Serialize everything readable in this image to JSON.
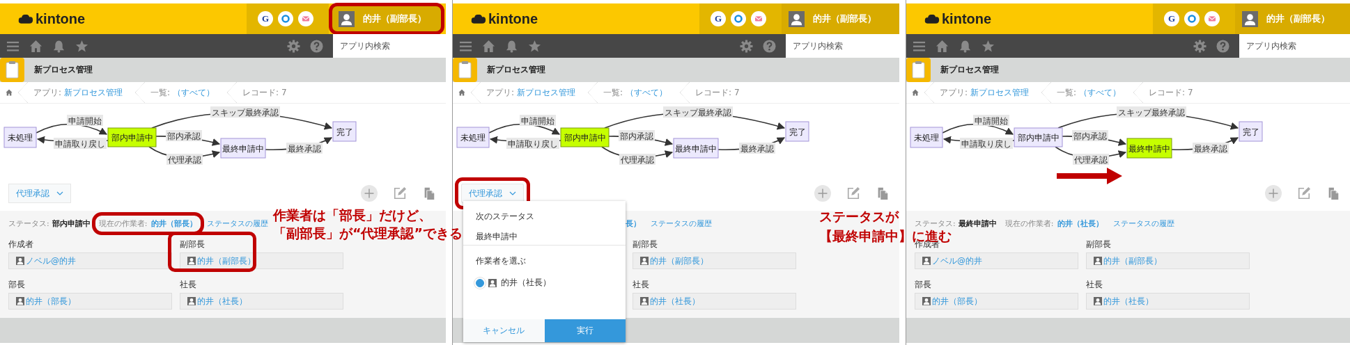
{
  "panels": [
    {
      "header": {
        "logo": "kintone",
        "badge": "G",
        "user": "的井（副部長）",
        "user_highlighted": true
      },
      "search": {
        "placeholder": "アプリ内検索"
      },
      "app_title": "新プロセス管理",
      "breadcrumb": [
        {
          "label": "アプリ:",
          "value": "新プロセス管理"
        },
        {
          "label": "一覧:",
          "value": "（すべて）"
        },
        {
          "label": "レコード: 7"
        }
      ],
      "diagram": {
        "nodes": [
          {
            "label": "未処理",
            "current": false
          },
          {
            "label": "部内申請中",
            "current": true
          },
          {
            "label": "最終申請中",
            "current": false
          },
          {
            "label": "完了",
            "current": false
          }
        ],
        "edges": [
          {
            "label": "申請開始"
          },
          {
            "label": "申請取り戻し"
          },
          {
            "label": "スキップ最終承認"
          },
          {
            "label": "部内承認"
          },
          {
            "label": "代理承認"
          },
          {
            "label": "最終承認"
          }
        ]
      },
      "action_button": {
        "label": "代理承認",
        "highlighted": false
      },
      "status": {
        "label": "ステータス:",
        "value": "部内申請中",
        "worker_label": "現在の作業者:",
        "worker": "的井（部長）",
        "worker_highlighted": true,
        "history": "ステータスの履歴"
      },
      "fields": [
        {
          "label": "作成者",
          "value": "ノベル@的井",
          "highlighted": false
        },
        {
          "label": "副部長",
          "value": "的井（副部長）",
          "highlighted": true
        },
        {
          "label": "部長",
          "value": "的井（部長）",
          "highlighted": false
        },
        {
          "label": "社長",
          "value": "的井（社長）",
          "highlighted": false
        }
      ]
    },
    {
      "header": {
        "logo": "kintone",
        "badge": "G",
        "user": "的井（副部長）",
        "user_highlighted": false
      },
      "search": {
        "placeholder": "アプリ内検索"
      },
      "app_title": "新プロセス管理",
      "breadcrumb": [
        {
          "label": "アプリ:",
          "value": "新プロセス管理"
        },
        {
          "label": "一覧:",
          "value": "（すべて）"
        },
        {
          "label": "レコード: 7"
        }
      ],
      "diagram": {
        "nodes": [
          {
            "label": "未処理",
            "current": false
          },
          {
            "label": "部内申請中",
            "current": true
          },
          {
            "label": "最終申請中",
            "current": false
          },
          {
            "label": "完了",
            "current": false
          }
        ],
        "edges": [
          {
            "label": "申請開始"
          },
          {
            "label": "申請取り戻し"
          },
          {
            "label": "スキップ最終承認"
          },
          {
            "label": "部内承認"
          },
          {
            "label": "代理承認"
          },
          {
            "label": "最終承認"
          }
        ]
      },
      "action_button": {
        "label": "代理承認",
        "highlighted": true
      },
      "status": {
        "worker": "長）",
        "worker_highlighted": false,
        "history": "ステータスの履歴"
      },
      "fields": [
        {
          "label": "副部長",
          "value": "的井（副部長）",
          "highlighted": false
        },
        {
          "label": "社長",
          "value": "的井（社長）",
          "highlighted": false
        }
      ],
      "dropdown": {
        "heading": "次のステータス",
        "next_status": "最終申請中",
        "assignee_heading": "作業者を選ぶ",
        "assignees": [
          {
            "name": "的井（社長）",
            "selected": true
          }
        ],
        "cancel": "キャンセル",
        "submit": "実行"
      }
    },
    {
      "header": {
        "logo": "kintone",
        "badge": "G",
        "user": "的井（副部長）",
        "user_highlighted": false
      },
      "search": {
        "placeholder": "アプリ内検索"
      },
      "app_title": "新プロセス管理",
      "breadcrumb": [
        {
          "label": "アプリ:",
          "value": "新プロセス管理"
        },
        {
          "label": "一覧:",
          "value": "（すべて）"
        },
        {
          "label": "レコード: 7"
        }
      ],
      "diagram": {
        "nodes": [
          {
            "label": "未処理",
            "current": false
          },
          {
            "label": "部内申請中",
            "current": false
          },
          {
            "label": "最終申請中",
            "current": true
          },
          {
            "label": "完了",
            "current": false
          }
        ],
        "edges": [
          {
            "label": "申請開始"
          },
          {
            "label": "申請取り戻し"
          },
          {
            "label": "スキップ最終承認"
          },
          {
            "label": "部内承認"
          },
          {
            "label": "代理承認"
          },
          {
            "label": "最終承認"
          }
        ]
      },
      "progress_arrow": true,
      "status": {
        "label": "ステータス:",
        "value": "最終申請中",
        "worker_label": "現在の作業者:",
        "worker": "的井（社長）",
        "worker_highlighted": false,
        "history": "ステータスの履歴"
      },
      "fields": [
        {
          "label": "作成者",
          "value": "ノベル@的井",
          "highlighted": false
        },
        {
          "label": "副部長",
          "value": "的井（副部長）",
          "highlighted": false
        },
        {
          "label": "部長",
          "value": "的井（部長）",
          "highlighted": false
        },
        {
          "label": "社長",
          "value": "的井（社長）",
          "highlighted": false
        }
      ]
    }
  ],
  "annotations": [
    {
      "lines": [
        "作業者は「部長」だけど、",
        "「副部長」が“代理承認”できる"
      ]
    },
    {
      "lines": [
        "ステータスが",
        "【最終申請中】に進む"
      ]
    }
  ]
}
